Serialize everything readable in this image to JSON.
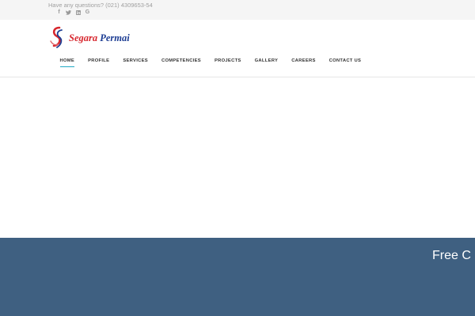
{
  "topbar": {
    "question": "Have any questions? (021) 4309653-54",
    "social": [
      {
        "icon": "facebook-icon",
        "glyph": "f"
      },
      {
        "icon": "twitter-icon",
        "glyph": ""
      },
      {
        "icon": "linkedin-icon",
        "glyph": ""
      },
      {
        "icon": "google-icon",
        "glyph": "G"
      }
    ]
  },
  "logo": {
    "word1": "Segara",
    "word2": "Permai"
  },
  "nav": {
    "items": [
      {
        "label": "HOME",
        "active": true
      },
      {
        "label": "PROFILE"
      },
      {
        "label": "SERVICES"
      },
      {
        "label": "COMPETENCIES"
      },
      {
        "label": "PROJECTS"
      },
      {
        "label": "GALLERY"
      },
      {
        "label": "CAREERS"
      },
      {
        "label": "CONTACT US"
      }
    ],
    "accent": "#22a9c4"
  },
  "band": {
    "text": "Free C",
    "color": "#3f6081"
  }
}
